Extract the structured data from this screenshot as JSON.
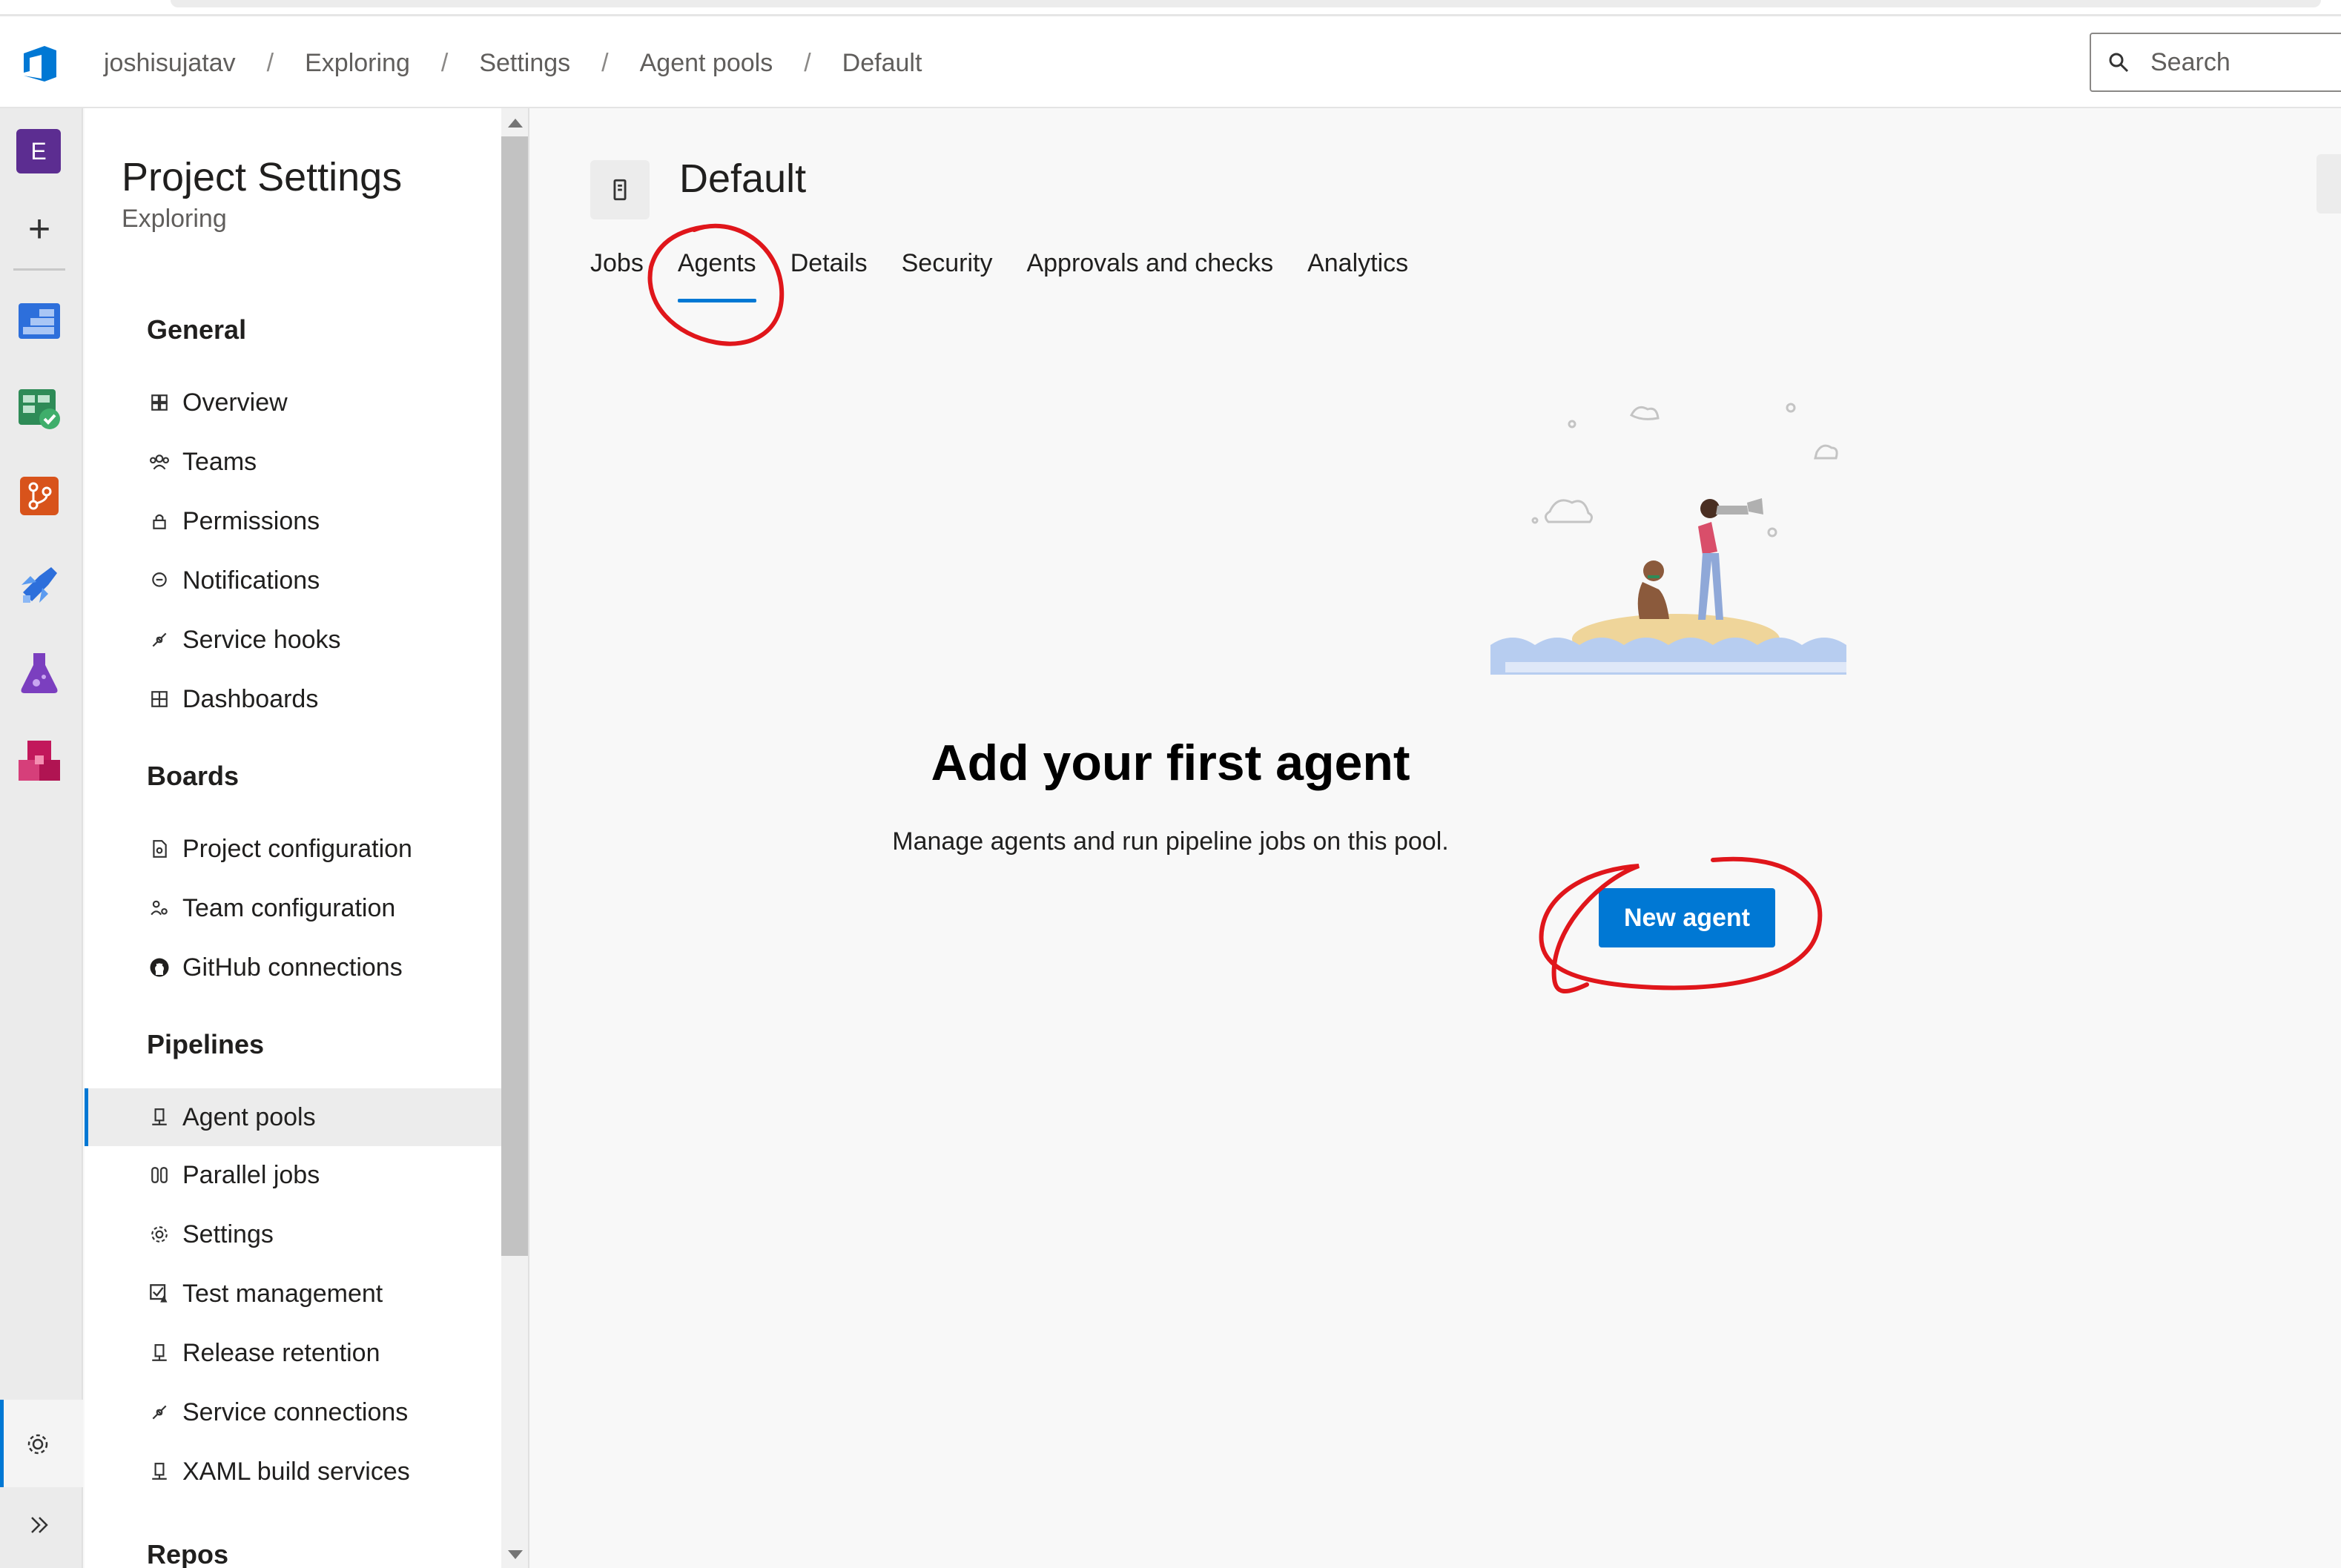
{
  "breadcrumb": {
    "items": [
      "joshisujatav",
      "Exploring",
      "Settings",
      "Agent pools",
      "Default"
    ],
    "separator": "/"
  },
  "search": {
    "placeholder": "Search"
  },
  "rail": {
    "avatar_letter": "E",
    "icons": [
      "overview-icon",
      "boards-icon",
      "repos-icon",
      "pipelines-icon",
      "test-plans-icon",
      "artifacts-icon",
      "project-settings-icon",
      "expand-icon"
    ]
  },
  "sidebar": {
    "title": "Project Settings",
    "subtitle": "Exploring",
    "groups": {
      "general": {
        "title": "General",
        "items": [
          "Overview",
          "Teams",
          "Permissions",
          "Notifications",
          "Service hooks",
          "Dashboards"
        ]
      },
      "boards": {
        "title": "Boards",
        "items": [
          "Project configuration",
          "Team configuration",
          "GitHub connections"
        ]
      },
      "pipelines": {
        "title": "Pipelines",
        "items": [
          "Agent pools",
          "Parallel jobs",
          "Settings",
          "Test management",
          "Release retention",
          "Service connections",
          "XAML build services"
        ]
      },
      "repos": {
        "title": "Repos"
      }
    },
    "selected": "Agent pools"
  },
  "main": {
    "title": "Default",
    "tabs": [
      "Jobs",
      "Agents",
      "Details",
      "Security",
      "Approvals and checks",
      "Analytics"
    ],
    "active_tab": "Agents",
    "empty_state": {
      "title": "Add your first agent",
      "description": "Manage agents and run pipeline jobs on this pool.",
      "button": "New agent"
    }
  },
  "colors": {
    "accent": "#0078d4",
    "annotation": "#e0161b",
    "avatar": "#5c2d91"
  }
}
